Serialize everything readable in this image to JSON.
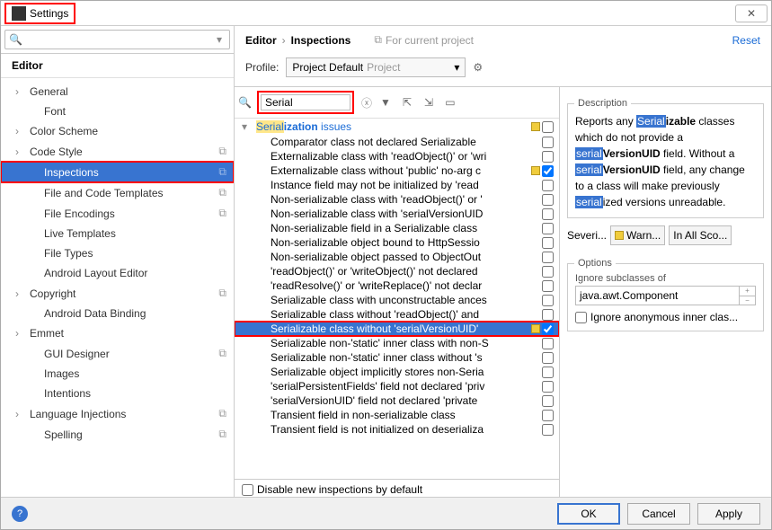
{
  "window": {
    "title": "Settings"
  },
  "leftSearch": {
    "placeholder": ""
  },
  "editorHeader": "Editor",
  "tree": [
    {
      "label": "General",
      "expandable": true
    },
    {
      "label": "Font",
      "expandable": false,
      "child": true
    },
    {
      "label": "Color Scheme",
      "expandable": true
    },
    {
      "label": "Code Style",
      "expandable": true,
      "copy": true
    },
    {
      "label": "Inspections",
      "expandable": false,
      "child": true,
      "selected": true,
      "copy": true,
      "red": true
    },
    {
      "label": "File and Code Templates",
      "expandable": false,
      "child": true,
      "copy": true
    },
    {
      "label": "File Encodings",
      "expandable": false,
      "child": true,
      "copy": true
    },
    {
      "label": "Live Templates",
      "expandable": false,
      "child": true
    },
    {
      "label": "File Types",
      "expandable": false,
      "child": true
    },
    {
      "label": "Android Layout Editor",
      "expandable": false,
      "child": true
    },
    {
      "label": "Copyright",
      "expandable": true,
      "copy": true
    },
    {
      "label": "Android Data Binding",
      "expandable": false,
      "child": true
    },
    {
      "label": "Emmet",
      "expandable": true
    },
    {
      "label": "GUI Designer",
      "expandable": false,
      "child": true,
      "copy": true
    },
    {
      "label": "Images",
      "expandable": false,
      "child": true
    },
    {
      "label": "Intentions",
      "expandable": false,
      "child": true
    },
    {
      "label": "Language Injections",
      "expandable": true,
      "copy": true
    },
    {
      "label": "Spelling",
      "expandable": false,
      "child": true,
      "copy": true
    }
  ],
  "breadcrumb": {
    "main": "Editor",
    "sub": "Inspections",
    "forProject": "For current project",
    "reset": "Reset"
  },
  "profile": {
    "label": "Profile:",
    "value": "Project Default",
    "suffix": "Project"
  },
  "filter": {
    "value": "Serial"
  },
  "group": {
    "prefix": "Serial",
    "suffix": "ization",
    "rest": " issues"
  },
  "inspections": [
    {
      "label": "Comparator class not declared Serializable",
      "checked": false
    },
    {
      "label": "Externalizable class with 'readObject()' or 'wri",
      "checked": false
    },
    {
      "label": "Externalizable class without 'public' no-arg c",
      "checked": true,
      "sev": true
    },
    {
      "label": "Instance field may not be initialized by 'read",
      "checked": false
    },
    {
      "label": "Non-serializable class with 'readObject()' or '",
      "checked": false
    },
    {
      "label": "Non-serializable class with 'serialVersionUID",
      "checked": false
    },
    {
      "label": "Non-serializable field in a Serializable class",
      "checked": false
    },
    {
      "label": "Non-serializable object bound to HttpSessio",
      "checked": false
    },
    {
      "label": "Non-serializable object passed to ObjectOut",
      "checked": false
    },
    {
      "label": "'readObject()' or 'writeObject()' not declared",
      "checked": false
    },
    {
      "label": "'readResolve()' or 'writeReplace()' not declar",
      "checked": false
    },
    {
      "label": "Serializable class with unconstructable ances",
      "checked": false
    },
    {
      "label": "Serializable class without 'readObject()' and",
      "checked": false
    },
    {
      "label": "Serializable class without 'serialVersionUID'",
      "checked": true,
      "selected": true,
      "sev": true,
      "red": true
    },
    {
      "label": "Serializable non-'static' inner class with non-S",
      "checked": false
    },
    {
      "label": "Serializable non-'static' inner class without 's",
      "checked": false
    },
    {
      "label": "Serializable object implicitly stores non-Seria",
      "checked": false
    },
    {
      "label": "'serialPersistentFields' field not declared 'priv",
      "checked": false
    },
    {
      "label": "'serialVersionUID' field not declared 'private",
      "checked": false
    },
    {
      "label": "Transient field in non-serializable class",
      "checked": false
    },
    {
      "label": "Transient field is not initialized on deserializa",
      "checked": false
    }
  ],
  "disableNew": "Disable new inspections by default",
  "description": {
    "title": "Description",
    "parts": [
      "Reports any ",
      "Serial",
      "izable",
      " classes which do not provide a ",
      "serial",
      "VersionUID",
      " field. Without a ",
      "serial",
      "VersionUID",
      " field, any change to a class will make previously ",
      "serial",
      "ized versions unreadable."
    ]
  },
  "severity": {
    "label": "Severi...",
    "value": "Warn...",
    "scope": "In All Sco..."
  },
  "options": {
    "title": "Options",
    "subclassLabel": "Ignore subclasses of",
    "subclassValue": "java.awt.Component",
    "anonLabel": "Ignore anonymous inner clas..."
  },
  "buttons": {
    "ok": "OK",
    "cancel": "Cancel",
    "apply": "Apply"
  }
}
